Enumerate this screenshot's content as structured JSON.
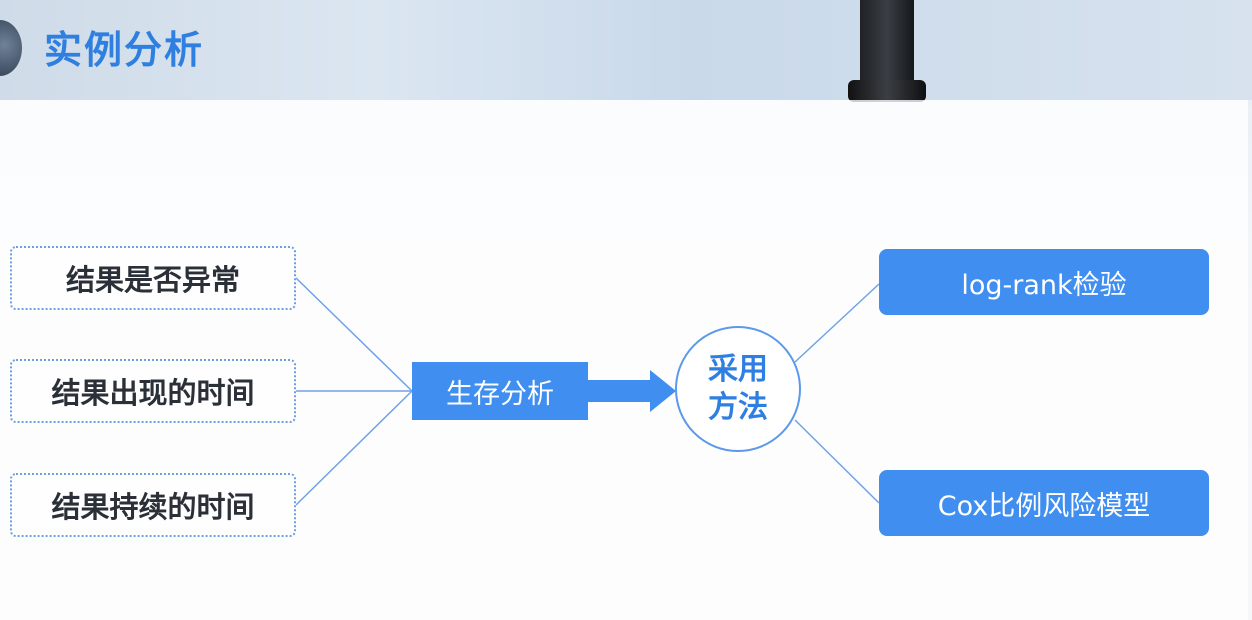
{
  "header": {
    "title": "实例分析"
  },
  "diagram": {
    "sources": [
      "结果是否异常",
      "结果出现的时间",
      "结果持续的时间"
    ],
    "hub": "生存分析",
    "method": {
      "line1": "采用",
      "line2": "方法"
    },
    "results": [
      "log-rank检验",
      "Cox比例风险模型"
    ]
  },
  "colors": {
    "accent": "#3f8ef0",
    "title": "#2f7fe0",
    "border": "#6e9fe0"
  }
}
